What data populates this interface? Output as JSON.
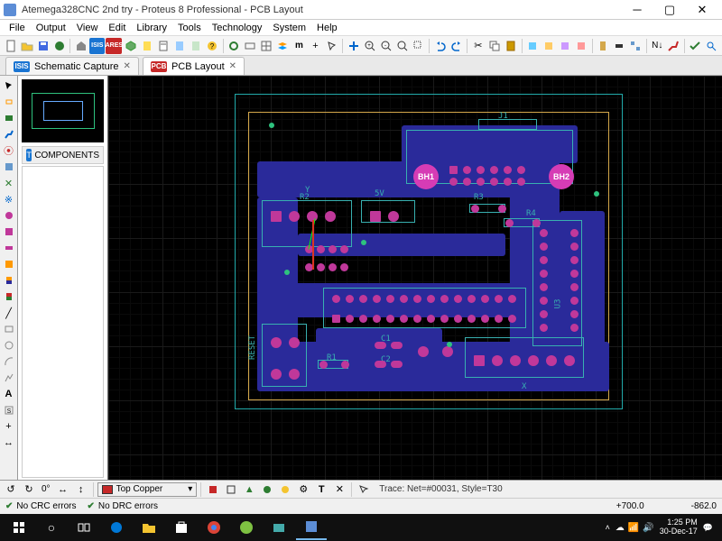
{
  "window": {
    "title": "Atemega328CNC 2nd try - Proteus 8 Professional - PCB Layout"
  },
  "menu": [
    "File",
    "Output",
    "View",
    "Edit",
    "Library",
    "Tools",
    "Technology",
    "System",
    "Help"
  ],
  "tabs": [
    {
      "badge": "ISIS",
      "label": "Schematic Capture",
      "active": false
    },
    {
      "badge": "PCB",
      "label": "PCB Layout",
      "active": true
    }
  ],
  "sidepanel": {
    "components_label": "COMPONENTS"
  },
  "bottombar": {
    "rotation": "0°",
    "layer": "Top Copper",
    "trace_info": "Trace: Net=#00031, Style=T30"
  },
  "statusbar": {
    "crc": "No CRC errors",
    "drc": "No DRC errors",
    "coord_x": "+700.0",
    "coord_y": "-862.0"
  },
  "board": {
    "designators": {
      "bh1": "BH1",
      "bh2": "BH2",
      "j1": "J1",
      "r3": "R3",
      "r4": "R4",
      "r2": "R2",
      "r1": "R1",
      "c1": "C1",
      "c2": "C2",
      "u3": "U3",
      "y": "Y",
      "x": "X",
      "reset": "RESET",
      "fiveV": "5V"
    }
  },
  "taskbar": {
    "time": "1:25 PM",
    "date": "30-Dec-17"
  }
}
